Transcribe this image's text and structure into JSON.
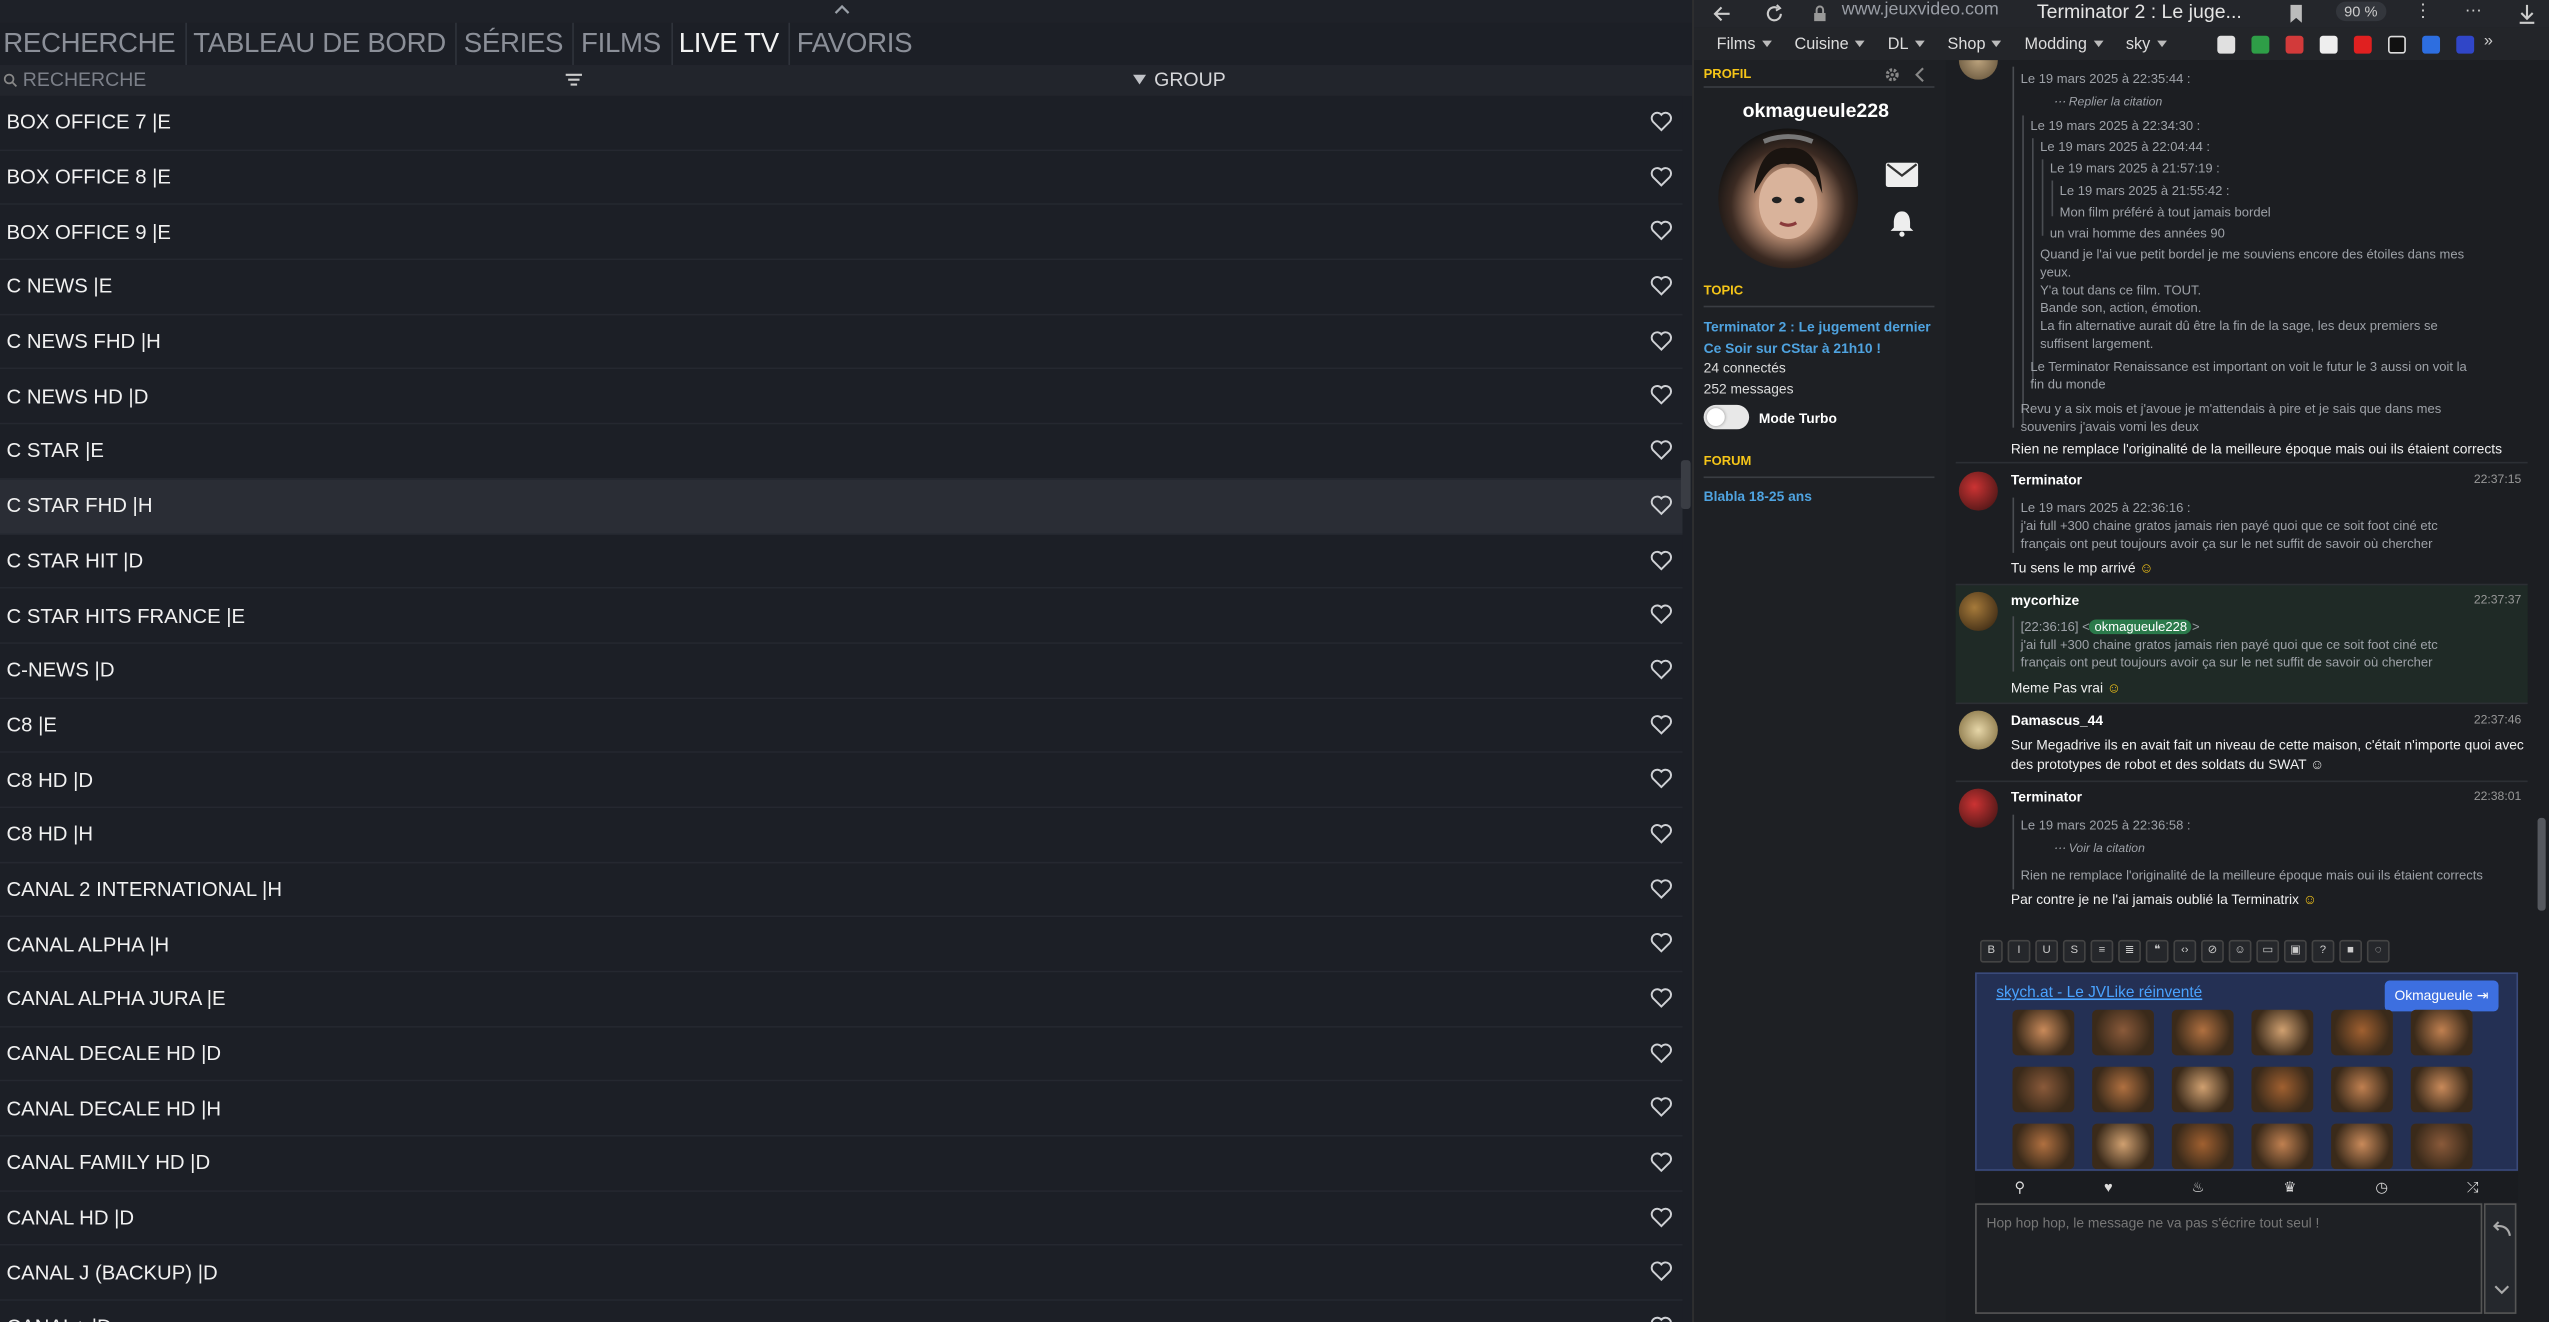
{
  "left_app": {
    "nav": [
      "RECHERCHE",
      "TABLEAU DE BORD",
      "SÉRIES",
      "FILMS",
      "LIVE TV",
      "FAVORIS"
    ],
    "active_nav": "LIVE TV",
    "search_placeholder": "RECHERCHE",
    "group_label": "GROUP",
    "channels": [
      "BOX OFFICE 7 |E",
      "BOX OFFICE 8 |E",
      "BOX OFFICE 9 |E",
      "C NEWS |E",
      "C NEWS FHD |H",
      "C NEWS HD |D",
      "C STAR |E",
      "C STAR FHD |H",
      "C STAR HIT |D",
      "C STAR HITS FRANCE |E",
      "C-NEWS |D",
      "C8 |E",
      "C8 HD |D",
      "C8 HD |H",
      "CANAL 2 INTERNATIONAL |H",
      "CANAL ALPHA |H",
      "CANAL ALPHA JURA |E",
      "CANAL DECALE HD |D",
      "CANAL DECALE HD |H",
      "CANAL FAMILY HD |D",
      "CANAL HD |D",
      "CANAL J (BACKUP) |D",
      "CANAL+ |D"
    ],
    "selected_channel": "C STAR FHD |H"
  },
  "browser": {
    "url": "www.jeuxvideo.com",
    "tab_title": "Terminator 2 : Le juge...",
    "zoom": "90 %",
    "bookmarks": [
      "Films",
      "Cuisine",
      "DL",
      "Shop",
      "Modding",
      "sky"
    ]
  },
  "profile": {
    "header": "PROFIL",
    "username": "okmagueule228",
    "topic_header": "TOPIC",
    "topic_title": "Terminator 2 : Le jugement dernier Ce Soir sur CStar à 21h10 !",
    "connected": "24 connectés",
    "messages": "252 messages",
    "turbo_label": "Mode Turbo",
    "forum_header": "FORUM",
    "forum_name": "Blabla 18-25 ans"
  },
  "chat": {
    "m0": {
      "q1": "Le 19 mars 2025 à 22:35:44 :",
      "q1b": "Replier la citation",
      "q2": "Le 19 mars 2025 à 22:34:30 :",
      "q3": "Le 19 mars 2025 à 22:04:44 :",
      "q4": "Le 19 mars 2025 à 21:57:19 :",
      "q5": "Le 19 mars 2025 à 21:55:42 :",
      "q6": "Mon film préféré à tout jamais bordel",
      "q7": "un vrai homme des années 90",
      "q8a": "Quand je l'ai vue petit bordel je me souviens encore des étoiles dans mes",
      "q8b": "yeux.",
      "q8c": "Y'a tout dans ce film. TOUT.",
      "q8d": "Bande son, action, émotion.",
      "q8e": "La fin alternative aurait dû être la fin de la sage, les deux premiers se",
      "q8f": "suffisent largement.",
      "q9a": "Le Terminator Renaissance est important on voit le futur le 3 aussi on voit la",
      "q9b": "fin du monde",
      "q10a": "Revu y a six mois et j'avoue je m'attendais à pire et je sais que dans mes",
      "q10b": "souvenirs j'avais vomi les deux",
      "text": "Rien ne remplace l'originalité de la meilleure époque mais oui ils étaient corrects"
    },
    "m1": {
      "name": "Terminator",
      "time": "22:37:15",
      "q1": "Le 19 mars 2025 à 22:36:16 :",
      "q2a": "j'ai full +300 chaine gratos jamais rien payé quoi que ce soit foot ciné etc",
      "q2b": "français ont peut toujours avoir ça sur le net suffit de savoir où chercher",
      "text": "Tu sens le mp arrivé"
    },
    "m2": {
      "name": "mycorhize",
      "time": "22:37:37",
      "qprefix": "[22:36:16] <",
      "qtag": "okmagueule228",
      "qsuffix": ">",
      "q2a": "j'ai full +300 chaine gratos jamais rien payé quoi que ce soit foot ciné etc",
      "q2b": "français ont peut toujours avoir ça sur le net suffit de savoir où chercher",
      "text": "Meme Pas vrai"
    },
    "m3": {
      "name": "Damascus_44",
      "time": "22:37:46",
      "text1": "Sur Megadrive ils en avait fait un niveau de cette maison, c'était n'importe quoi avec",
      "text2": "des prototypes de robot et des soldats du SWAT"
    },
    "m4": {
      "name": "Terminator",
      "time": "22:38:01",
      "q1": "Le 19 mars 2025 à 22:36:58 :",
      "q1b": "Voir la citation",
      "q2": "Rien ne remplace l'originalité de la meilleure époque mais oui ils étaient corrects",
      "text": "Par contre je ne l'ai jamais oublié la Terminatrix"
    }
  },
  "editor": {
    "toolbar": [
      "B",
      "I",
      "U",
      "S",
      "≡",
      "≣",
      "❝",
      "‹›",
      "⊘",
      "☺",
      "▭",
      "▣",
      "?",
      "■",
      "◌"
    ],
    "sticker_link": "skych.at - Le JVLike réinventé",
    "sticker_user": "Okmagueule",
    "placeholder": "Hop hop hop, le message ne va pas s'écrire tout seul !"
  }
}
